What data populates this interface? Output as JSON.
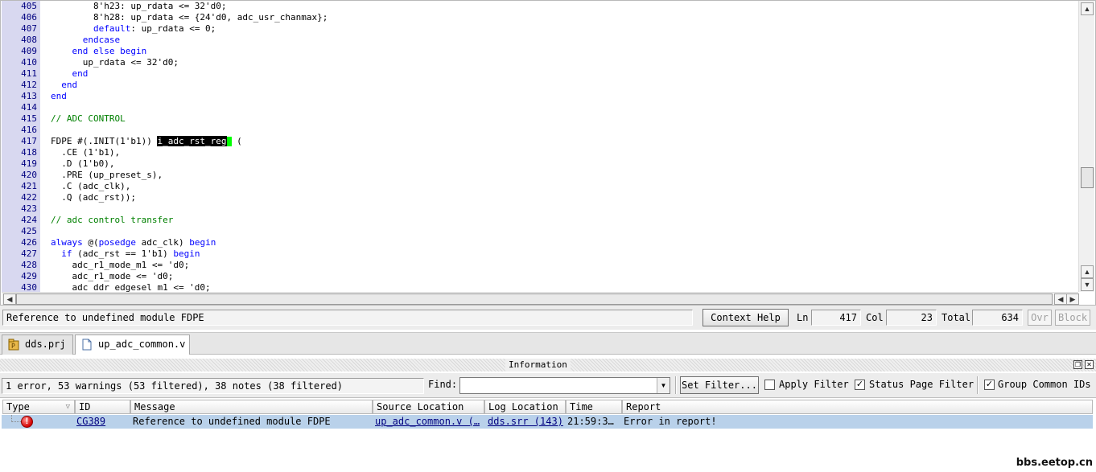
{
  "editor": {
    "lines": [
      {
        "n": "405",
        "code": "        8'h23: up_rdata <= 32'd0;"
      },
      {
        "n": "406",
        "code": "        8'h28: up_rdata <= {24'd0, adc_usr_chanmax};"
      },
      {
        "n": "407",
        "code": "        default: up_rdata <= 0;"
      },
      {
        "n": "408",
        "code": "      endcase"
      },
      {
        "n": "409",
        "code": "    end else begin"
      },
      {
        "n": "410",
        "code": "      up_rdata <= 32'd0;"
      },
      {
        "n": "411",
        "code": "    end"
      },
      {
        "n": "412",
        "code": "  end"
      },
      {
        "n": "413",
        "code": "end"
      },
      {
        "n": "414",
        "code": ""
      },
      {
        "n": "415",
        "code": "// ADC CONTROL"
      },
      {
        "n": "416",
        "code": ""
      },
      {
        "n": "417",
        "code": "FDPE #(.INIT(1'b1)) i_adc_rst_reg ("
      },
      {
        "n": "418",
        "code": "  .CE (1'b1),"
      },
      {
        "n": "419",
        "code": "  .D (1'b0),"
      },
      {
        "n": "420",
        "code": "  .PRE (up_preset_s),"
      },
      {
        "n": "421",
        "code": "  .C (adc_clk),"
      },
      {
        "n": "422",
        "code": "  .Q (adc_rst));"
      },
      {
        "n": "423",
        "code": ""
      },
      {
        "n": "424",
        "code": "// adc control transfer"
      },
      {
        "n": "425",
        "code": ""
      },
      {
        "n": "426",
        "code": "always @(posedge adc_clk) begin"
      },
      {
        "n": "427",
        "code": "  if (adc_rst == 1'b1) begin"
      },
      {
        "n": "428",
        "code": "    adc_r1_mode_m1 <= 'd0;"
      },
      {
        "n": "429",
        "code": "    adc_r1_mode <= 'd0;"
      },
      {
        "n": "430",
        "code": "    adc_ddr_edgesel_m1 <= 'd0;"
      }
    ],
    "selected_text": "i_adc_rst_reg"
  },
  "status": {
    "message": "Reference to undefined module FDPE",
    "context_help": "Context Help",
    "ln_label": "Ln",
    "ln": "417",
    "col_label": "Col",
    "col": "23",
    "total_label": "Total",
    "total": "634",
    "ovr": "Ovr",
    "block": "Block"
  },
  "tabs": [
    {
      "label": "dds.prj",
      "icon": "project-icon",
      "active": false
    },
    {
      "label": "up_adc_common.v",
      "icon": "file-icon",
      "active": true
    }
  ],
  "info_panel": {
    "title": "Information",
    "summary": "1 error, 53 warnings (53 filtered), 38 notes (38 filtered)",
    "find_label": "Find:",
    "find_value": "",
    "set_filter": "Set Filter...",
    "apply_filter": {
      "label": "Apply Filter",
      "checked": false
    },
    "status_page_filter": {
      "label": "Status Page Filter",
      "checked": true
    },
    "group_common_ids": {
      "label": "Group Common IDs",
      "checked": true
    },
    "columns": [
      "Type",
      "ID",
      "Message",
      "Source Location",
      "Log Location",
      "Time",
      "Report"
    ],
    "rows": [
      {
        "type_icon": "error-icon",
        "id": "CG389",
        "message": "Reference to undefined module FDPE",
        "source": "up_adc_common.v (…",
        "log": "dds.srr (143)",
        "time": "21:59:3…",
        "report": "Error in report!"
      }
    ]
  },
  "watermark": "bbs.eetop.cn",
  "colors": {
    "gutter_bg": "#d8d8f0",
    "keyword": "#0000ff",
    "comment": "#008000",
    "selection_bg": "#000000",
    "cursor": "#00ff00",
    "selected_row_bg": "#b9d1ea"
  }
}
